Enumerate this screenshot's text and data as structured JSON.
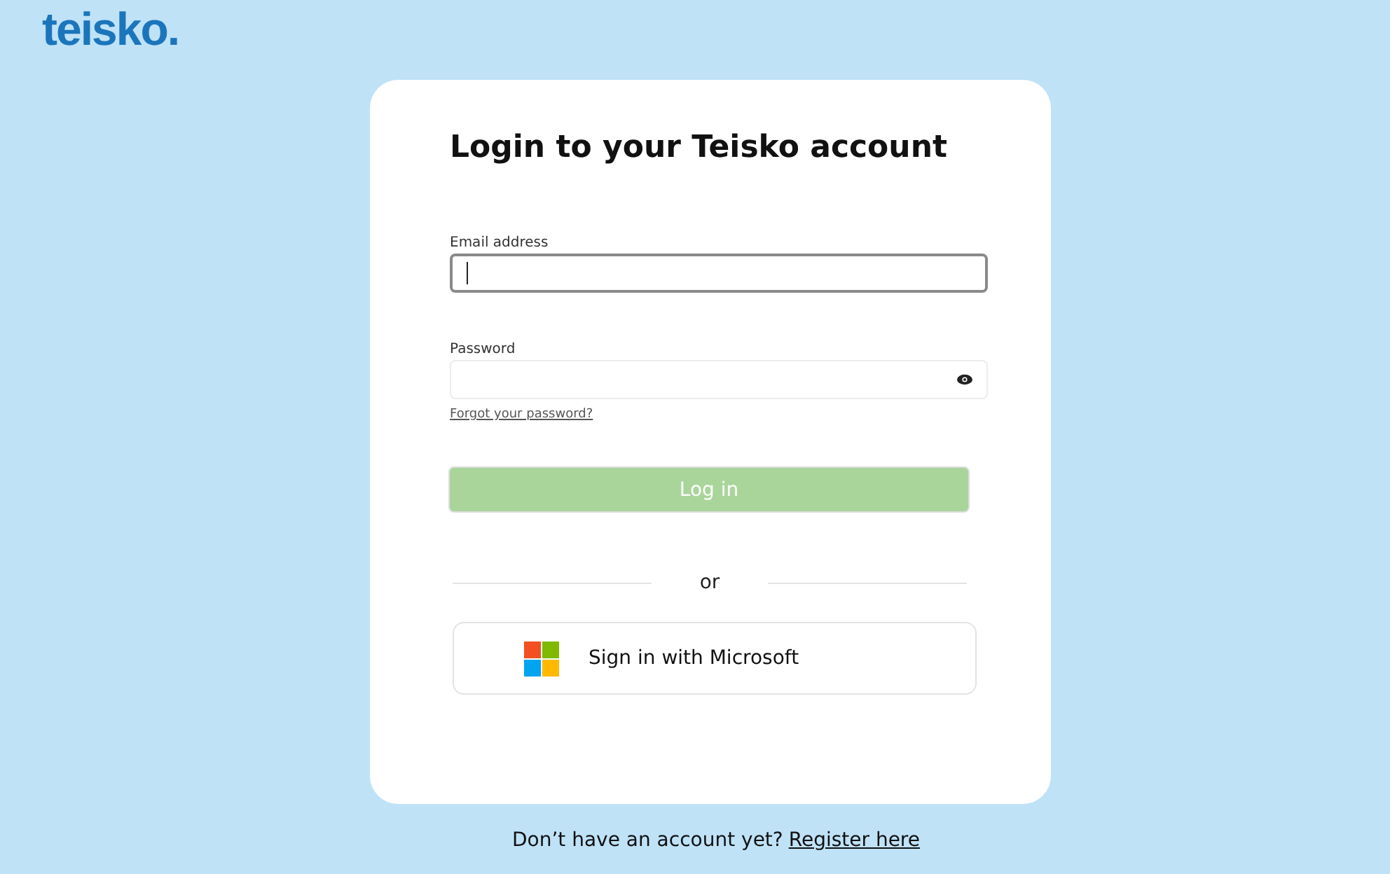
{
  "logo": {
    "text": "teisko."
  },
  "title": "Login to your Teisko account",
  "fields": [
    {
      "label": "Email address",
      "kind": "text",
      "focused": true
    },
    {
      "label": "Password",
      "kind": "password",
      "focused": false
    }
  ],
  "forgot_link": "Forgot your password?",
  "login_button": {
    "label": "Log in",
    "disabled": true
  },
  "divider": "or",
  "microsoft_button": {
    "label": "Sign in with Microsoft"
  },
  "footer": {
    "text": "Don’t have an account yet?",
    "link": "Register here"
  }
}
